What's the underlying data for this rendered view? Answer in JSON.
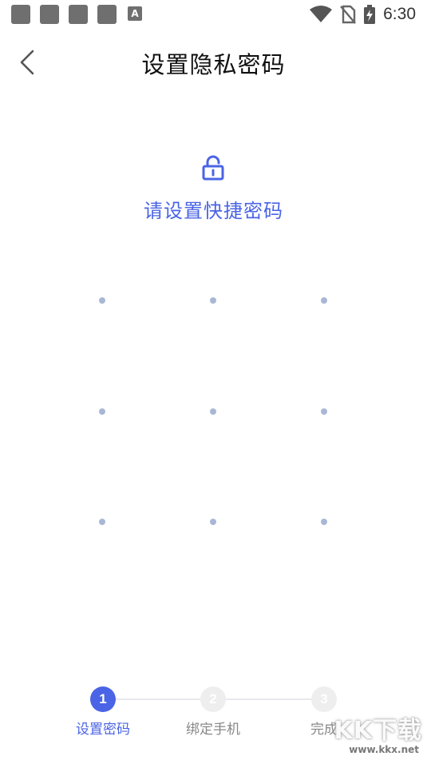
{
  "status_bar": {
    "time": "6:30",
    "left_icons": [
      "app-icon",
      "app-icon",
      "app-icon",
      "app-icon",
      "a-icon"
    ],
    "a_label": "A",
    "right_icons": [
      "wifi-icon",
      "no-sim-icon",
      "battery-charging-icon"
    ]
  },
  "header": {
    "title": "设置隐私密码",
    "back_icon": "chevron-left-icon"
  },
  "prompt": {
    "icon": "lock-open-icon",
    "text": "请设置快捷密码",
    "color": "#4a64e6"
  },
  "pattern": {
    "rows": 3,
    "cols": 3,
    "dot_color": "#a9b7d6"
  },
  "steps": [
    {
      "number": "1",
      "label": "设置密码",
      "active": true
    },
    {
      "number": "2",
      "label": "绑定手机",
      "active": false
    },
    {
      "number": "3",
      "label": "完成",
      "active": false
    }
  ],
  "watermark": {
    "text": "KK下载",
    "url": "www.kkx.net"
  },
  "colors": {
    "accent": "#4a64e6",
    "inactive_step": "#eeeeef",
    "text": "#111111"
  }
}
